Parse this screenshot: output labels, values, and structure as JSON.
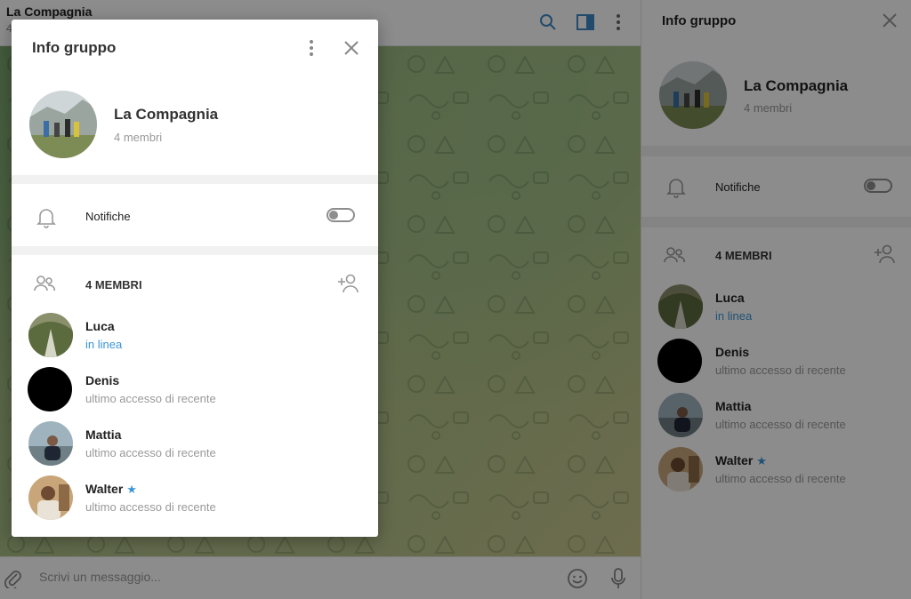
{
  "chat": {
    "title": "La Compagnia",
    "subtitle": "4",
    "composer_placeholder": "Scrivi un messaggio..."
  },
  "group": {
    "panel_title": "Info gruppo",
    "name": "La Compagnia",
    "member_count": "4 membri",
    "notifications_label": "Notifiche",
    "notifications_on": false,
    "members_header": "4 MEMBRI"
  },
  "members": [
    {
      "name": "Luca",
      "status": "in linea",
      "online": true,
      "starred": false
    },
    {
      "name": "Denis",
      "status": "ultimo accesso di recente",
      "online": false,
      "starred": false
    },
    {
      "name": "Mattia",
      "status": "ultimo accesso di recente",
      "online": false,
      "starred": false
    },
    {
      "name": "Walter",
      "status": "ultimo accesso di recente",
      "online": false,
      "starred": true
    }
  ],
  "colors": {
    "accent": "#3a95d6",
    "muted_text": "#999999",
    "separator": "#f1f1f1"
  },
  "icons": [
    "search-icon",
    "sidebar-toggle-icon",
    "more-vertical-icon",
    "close-icon",
    "bell-icon",
    "people-icon",
    "add-user-icon",
    "attach-icon",
    "emoji-icon",
    "microphone-icon",
    "star-icon"
  ]
}
